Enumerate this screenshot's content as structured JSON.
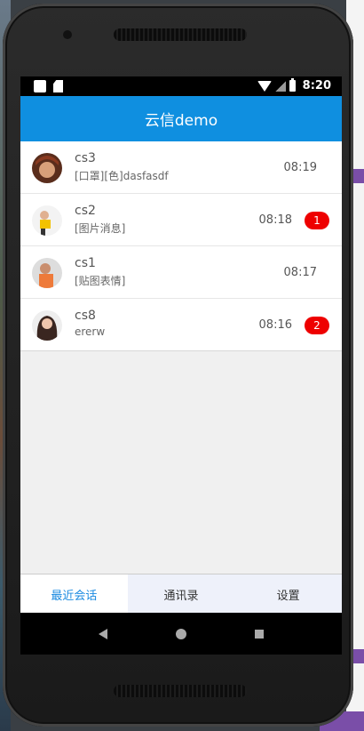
{
  "status_bar": {
    "time": "8:20"
  },
  "app_bar": {
    "title": "云信demo"
  },
  "conversations": [
    {
      "name": "cs3",
      "preview": "[口罩][色]dasfasdf",
      "time": "08:19",
      "unread": ""
    },
    {
      "name": "cs2",
      "preview": "[图片消息]",
      "time": "08:18",
      "unread": "1"
    },
    {
      "name": "cs1",
      "preview": "[贴图表情]",
      "time": "08:17",
      "unread": ""
    },
    {
      "name": "cs8",
      "preview": "ererw",
      "time": "08:16",
      "unread": "2"
    }
  ],
  "tabs": [
    {
      "label": "最近会话",
      "active": true
    },
    {
      "label": "通讯录",
      "active": false
    },
    {
      "label": "设置",
      "active": false
    }
  ],
  "colors": {
    "accent": "#0f8fe0",
    "badge": "#ee0000",
    "active_tab": "#1a8ae0"
  }
}
